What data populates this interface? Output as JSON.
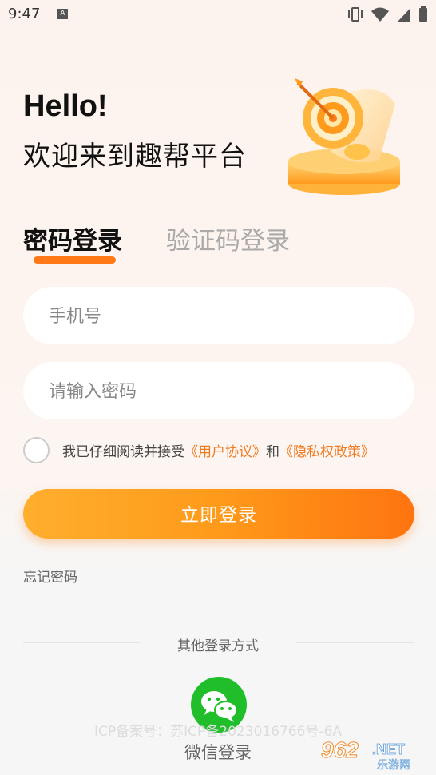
{
  "status_bar": {
    "time": "9:47",
    "notification_letter": "A"
  },
  "header": {
    "greeting": "Hello!",
    "welcome": "欢迎来到趣帮平台"
  },
  "tabs": [
    {
      "label": "密码登录",
      "active": true
    },
    {
      "label": "验证码登录",
      "active": false
    }
  ],
  "form": {
    "phone_placeholder": "手机号",
    "password_placeholder": "请输入密码"
  },
  "agreement": {
    "prefix": "我已仔细阅读并接受",
    "user_agreement": "《用户协议》",
    "and": "和",
    "privacy_policy": "《隐私权政策》"
  },
  "login_button": "立即登录",
  "forgot_password": "忘记密码",
  "other_login": "其他登录方式",
  "icp": "ICP备案号：苏ICP备2023016766号-6A",
  "wechat_login": "微信登录",
  "watermark": {
    "number": "962",
    "suffix": ".NET",
    "caption": "乐游网"
  },
  "colors": {
    "accent": "#ff7a16",
    "link": "#f07a1e",
    "wechat": "#1fbe2a"
  }
}
